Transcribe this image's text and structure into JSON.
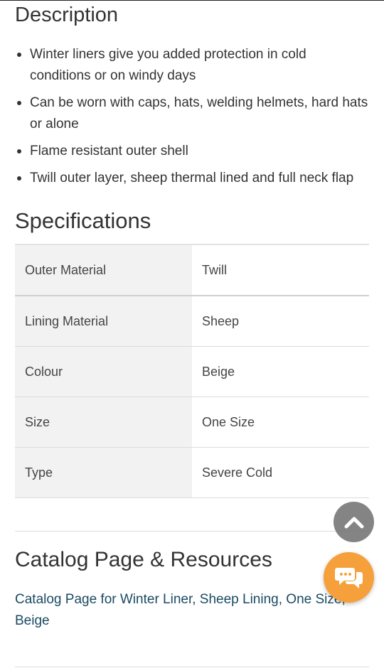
{
  "description": {
    "title": "Description",
    "bullets": [
      "Winter liners give you added protection in cold conditions or on windy days",
      "Can be worn with caps, hats, welding helmets, hard hats or alone",
      "Flame resistant outer shell",
      "Twill outer layer, sheep thermal lined and full neck flap"
    ]
  },
  "specifications": {
    "title": "Specifications",
    "rows": [
      {
        "label": "Outer Material",
        "value": "Twill"
      },
      {
        "label": "Lining Material",
        "value": "Sheep"
      },
      {
        "label": "Colour",
        "value": "Beige"
      },
      {
        "label": "Size",
        "value": "One Size"
      },
      {
        "label": "Type",
        "value": "Severe Cold"
      }
    ]
  },
  "catalog": {
    "title": "Catalog Page & Resources",
    "link_text": "Catalog Page for Winter Liner, Sheep Lining, One Size, Beige"
  },
  "floating": {
    "scroll_top_icon": "chevron-up-icon",
    "chat_icon": "chat-bubbles-icon",
    "chat_color": "#f5a03a",
    "scroll_top_color": "#6e6e6e"
  },
  "colors": {
    "text": "#333333",
    "link": "#1a4a63",
    "table_label_bg": "#f2f2f3"
  }
}
